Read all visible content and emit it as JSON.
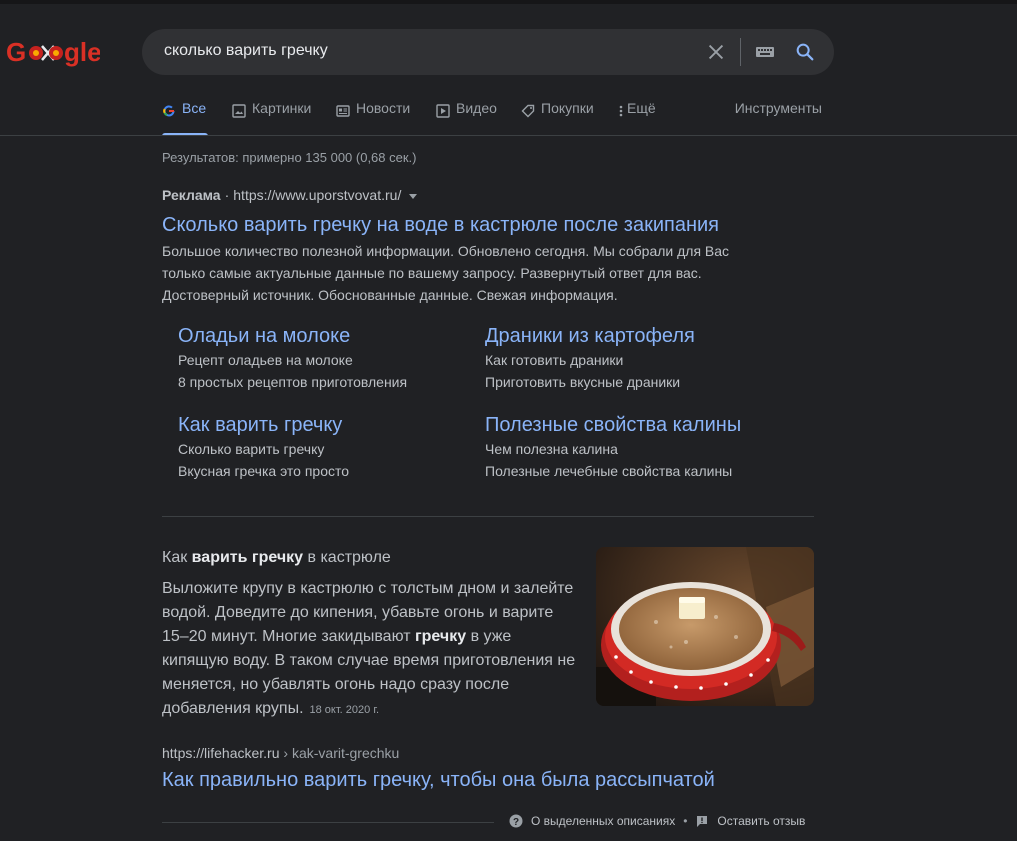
{
  "logo": {
    "text": "Google"
  },
  "search": {
    "query": "сколько варить гречку"
  },
  "tabs": [
    {
      "label": "Все",
      "icon": "google-g-icon"
    },
    {
      "label": "Картинки",
      "icon": "image-icon"
    },
    {
      "label": "Новости",
      "icon": "news-icon"
    },
    {
      "label": "Видео",
      "icon": "play-icon"
    },
    {
      "label": "Покупки",
      "icon": "tag-icon"
    },
    {
      "label": "Ещё",
      "icon": "more-vert-icon"
    }
  ],
  "tools_label": "Инструменты",
  "stats": "Результатов: примерно 135 000 (0,68 сек.)",
  "ad": {
    "badge": "Реклама",
    "separator": "·",
    "url": "https://www.uporstvovat.ru/",
    "title": "Сколько варить гречку на воде в кастрюле после закипания",
    "description": "Большое количество полезной информации. Обновлено сегодня. Мы собрали для Вас только самые актуальные данные по вашему запросу. Развернутый ответ для вас. Достоверный источник. Обоснованные данные. Свежая информация.",
    "sitelinks": [
      {
        "title": "Оладьи на молоке",
        "line1": "Рецепт оладьев на молоке",
        "line2": "8 простых рецептов приготовления"
      },
      {
        "title": "Драники из картофеля",
        "line1": "Как готовить драники",
        "line2": "Приготовить вкусные драники"
      },
      {
        "title": "Как варить гречку",
        "line1": "Сколько варить гречку",
        "line2": "Вкусная гречка это просто"
      },
      {
        "title": "Полезные свойства калины",
        "line1": "Чем полезна калина",
        "line2": "Полезные лечебные свойства калины"
      }
    ]
  },
  "snippet": {
    "head_pre": "Как ",
    "head_bold": "варить гречку",
    "head_post": " в кастрюле",
    "body_1": "Выложите крупу в кастрюлю с толстым дном и залейте водой. Доведите до кипения, убавьте огонь и варите 15–20 минут. Многие закидывают ",
    "body_bold": "гречку",
    "body_2": " в уже кипящую воду. В таком случае время приготовления не меняется, но убавлять огонь надо сразу после добавления крупы.",
    "date": "18 окт. 2020 г."
  },
  "result": {
    "domain": "https://lifehacker.ru",
    "path": " › kak-varit-grechku",
    "title": "Как правильно варить гречку, чтобы она была рассыпчатой"
  },
  "footer": {
    "about": "О выделенных описаниях",
    "dot": "•",
    "feedback": "Оставить отзыв"
  }
}
